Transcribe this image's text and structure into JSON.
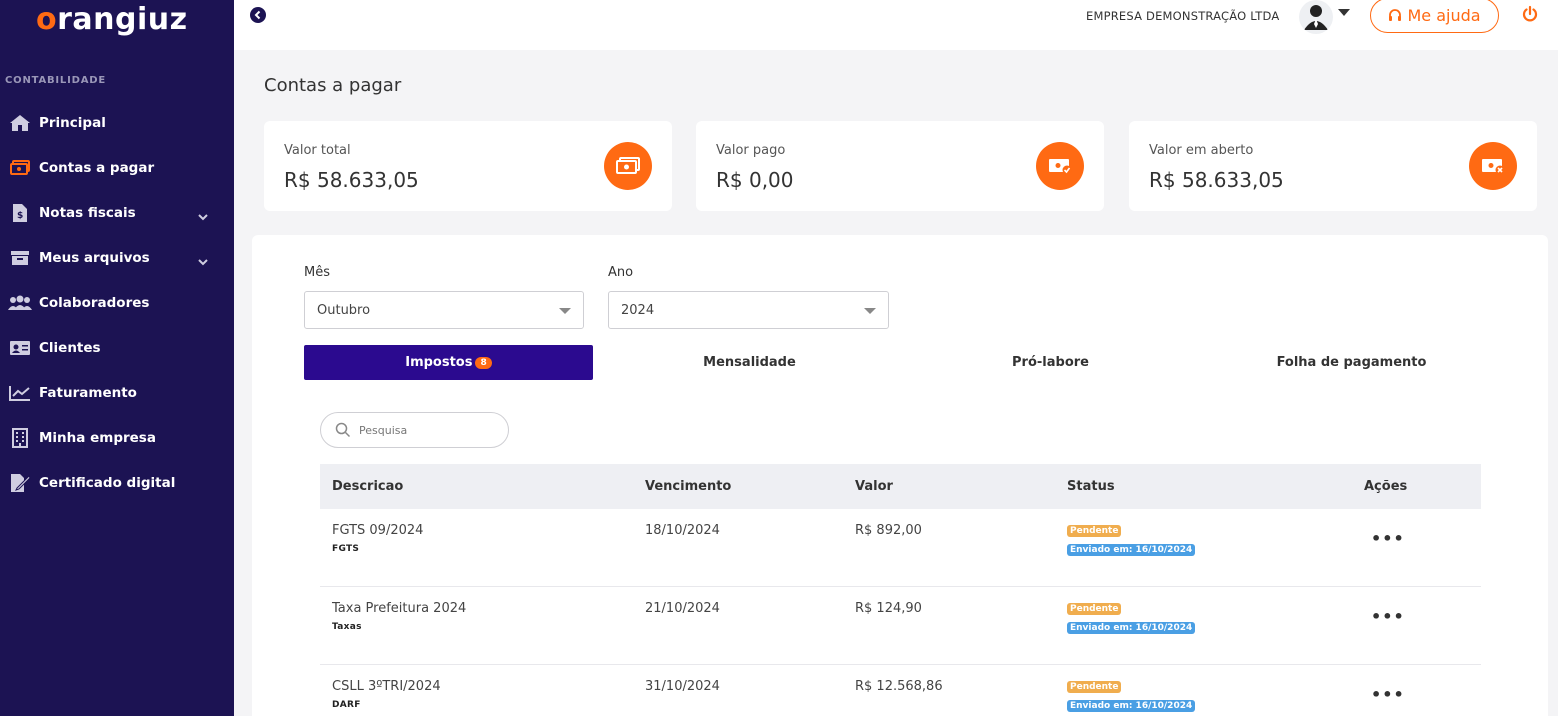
{
  "brand": {
    "logo_first": "o",
    "logo_rest": "rangiuz",
    "accent": "#ff6a13",
    "sidebar_bg": "#1c1353"
  },
  "sidebar": {
    "section": "CONTABILIDADE",
    "items": [
      {
        "label": "Principal",
        "icon": "home-icon"
      },
      {
        "label": "Contas a pagar",
        "icon": "money-icon",
        "active": true
      },
      {
        "label": "Notas fiscais",
        "icon": "invoice-icon",
        "expandable": true
      },
      {
        "label": "Meus arquivos",
        "icon": "archive-icon",
        "expandable": true
      },
      {
        "label": "Colaboradores",
        "icon": "users-icon"
      },
      {
        "label": "Clientes",
        "icon": "id-card-icon"
      },
      {
        "label": "Faturamento",
        "icon": "chart-icon"
      },
      {
        "label": "Minha empresa",
        "icon": "building-icon"
      },
      {
        "label": "Certificado digital",
        "icon": "certificate-icon"
      }
    ]
  },
  "topbar": {
    "company": "EMPRESA DEMONSTRAÇÃO LTDA",
    "help_label": "Me ajuda"
  },
  "page": {
    "title": "Contas a pagar"
  },
  "cards": [
    {
      "label": "Valor total",
      "value": "R$ 58.633,05",
      "icon": "money-icon"
    },
    {
      "label": "Valor pago",
      "value": "R$ 0,00",
      "icon": "money-check-icon"
    },
    {
      "label": "Valor em aberto",
      "value": "R$ 58.633,05",
      "icon": "money-x-icon"
    }
  ],
  "filters": {
    "month_label": "Mês",
    "month_value": "Outubro",
    "year_label": "Ano",
    "year_value": "2024"
  },
  "tabs": [
    {
      "label": "Impostos",
      "badge": "8",
      "active": true
    },
    {
      "label": "Mensalidade"
    },
    {
      "label": "Pró-labore"
    },
    {
      "label": "Folha de pagamento"
    }
  ],
  "search": {
    "placeholder": "Pesquisa"
  },
  "table": {
    "headers": {
      "descricao": "Descricao",
      "vencimento": "Vencimento",
      "valor": "Valor",
      "status": "Status",
      "acoes": "Ações"
    },
    "rows": [
      {
        "descricao": "FGTS 09/2024",
        "tipo": "FGTS",
        "vencimento": "18/10/2024",
        "valor": "R$ 892,00",
        "status": "Pendente",
        "enviado": "Enviado em: 16/10/2024",
        "acoes": "•••"
      },
      {
        "descricao": "Taxa Prefeitura 2024",
        "tipo": "Taxas",
        "vencimento": "21/10/2024",
        "valor": "R$ 124,90",
        "status": "Pendente",
        "enviado": "Enviado em: 16/10/2024",
        "acoes": "•••"
      },
      {
        "descricao": "CSLL 3ºTRI/2024",
        "tipo": "DARF",
        "vencimento": "31/10/2024",
        "valor": "R$ 12.568,86",
        "status": "Pendente",
        "enviado": "Enviado em: 16/10/2024",
        "acoes": "•••"
      }
    ]
  }
}
